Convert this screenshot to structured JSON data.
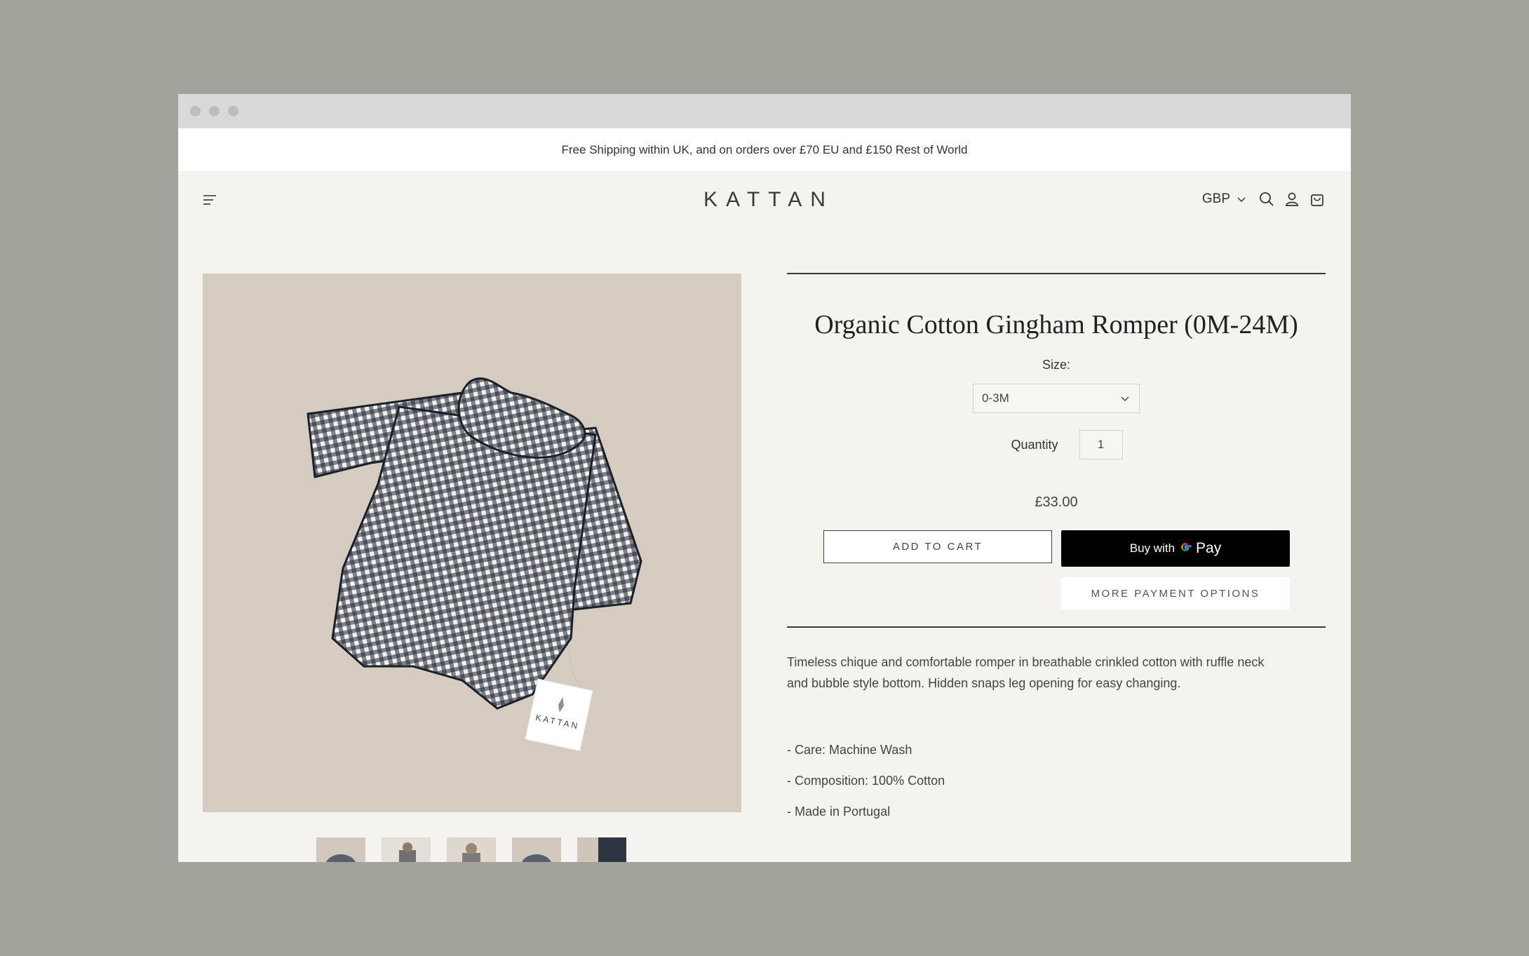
{
  "announcement": "Free Shipping within UK, and on orders over £70 EU and £150 Rest of World",
  "brand": {
    "logo": "KATTAN"
  },
  "header": {
    "currency": "GBP"
  },
  "product": {
    "title": "Organic Cotton Gingham Romper (0M-24M)",
    "size_label": "Size:",
    "size_selected": "0-3M",
    "quantity_label": "Quantity",
    "quantity_value": "1",
    "price": "£33.00",
    "add_to_cart": "ADD TO CART",
    "buy_with": "Buy with",
    "pay": "Pay",
    "more_payment": "MORE PAYMENT OPTIONS",
    "tag_text": "KATTAN",
    "description": "Timeless chique and comfortable romper in breathable crinkled cotton with ruffle neck and bubble style bottom. Hidden snaps leg opening for easy changing.",
    "specs": [
      "- Care: Machine Wash",
      "- Composition: 100% Cotton",
      "- Made in Portugal"
    ]
  },
  "colors": {
    "background": "#a3a39b",
    "page": "#f5f3ef",
    "image_bg": "#d5cbc0",
    "gingham_dark": "#1f2733",
    "gpay_button": "#000000"
  },
  "icons": [
    "menu-icon",
    "chevron-down-icon",
    "search-icon",
    "account-icon",
    "cart-icon",
    "google-g-icon"
  ]
}
